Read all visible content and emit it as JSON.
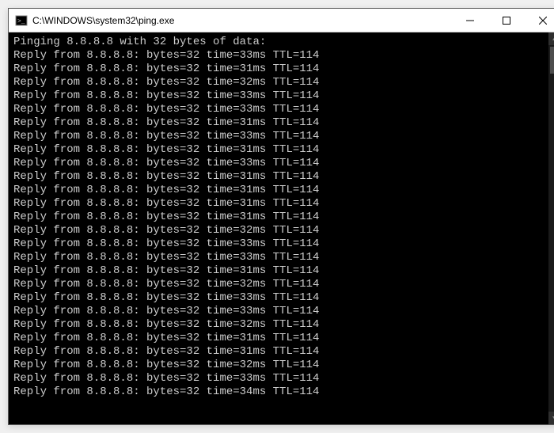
{
  "window": {
    "title": "C:\\WINDOWS\\system32\\ping.exe"
  },
  "console": {
    "header": "Pinging 8.8.8.8 with 32 bytes of data:",
    "replies": [
      {
        "from": "8.8.8.8",
        "bytes": 32,
        "time_ms": 33,
        "ttl": 114
      },
      {
        "from": "8.8.8.8",
        "bytes": 32,
        "time_ms": 31,
        "ttl": 114
      },
      {
        "from": "8.8.8.8",
        "bytes": 32,
        "time_ms": 32,
        "ttl": 114
      },
      {
        "from": "8.8.8.8",
        "bytes": 32,
        "time_ms": 33,
        "ttl": 114
      },
      {
        "from": "8.8.8.8",
        "bytes": 32,
        "time_ms": 33,
        "ttl": 114
      },
      {
        "from": "8.8.8.8",
        "bytes": 32,
        "time_ms": 31,
        "ttl": 114
      },
      {
        "from": "8.8.8.8",
        "bytes": 32,
        "time_ms": 33,
        "ttl": 114
      },
      {
        "from": "8.8.8.8",
        "bytes": 32,
        "time_ms": 31,
        "ttl": 114
      },
      {
        "from": "8.8.8.8",
        "bytes": 32,
        "time_ms": 33,
        "ttl": 114
      },
      {
        "from": "8.8.8.8",
        "bytes": 32,
        "time_ms": 31,
        "ttl": 114
      },
      {
        "from": "8.8.8.8",
        "bytes": 32,
        "time_ms": 31,
        "ttl": 114
      },
      {
        "from": "8.8.8.8",
        "bytes": 32,
        "time_ms": 31,
        "ttl": 114
      },
      {
        "from": "8.8.8.8",
        "bytes": 32,
        "time_ms": 31,
        "ttl": 114
      },
      {
        "from": "8.8.8.8",
        "bytes": 32,
        "time_ms": 32,
        "ttl": 114
      },
      {
        "from": "8.8.8.8",
        "bytes": 32,
        "time_ms": 33,
        "ttl": 114
      },
      {
        "from": "8.8.8.8",
        "bytes": 32,
        "time_ms": 33,
        "ttl": 114
      },
      {
        "from": "8.8.8.8",
        "bytes": 32,
        "time_ms": 31,
        "ttl": 114
      },
      {
        "from": "8.8.8.8",
        "bytes": 32,
        "time_ms": 32,
        "ttl": 114
      },
      {
        "from": "8.8.8.8",
        "bytes": 32,
        "time_ms": 33,
        "ttl": 114
      },
      {
        "from": "8.8.8.8",
        "bytes": 32,
        "time_ms": 33,
        "ttl": 114
      },
      {
        "from": "8.8.8.8",
        "bytes": 32,
        "time_ms": 32,
        "ttl": 114
      },
      {
        "from": "8.8.8.8",
        "bytes": 32,
        "time_ms": 31,
        "ttl": 114
      },
      {
        "from": "8.8.8.8",
        "bytes": 32,
        "time_ms": 31,
        "ttl": 114
      },
      {
        "from": "8.8.8.8",
        "bytes": 32,
        "time_ms": 32,
        "ttl": 114
      },
      {
        "from": "8.8.8.8",
        "bytes": 32,
        "time_ms": 33,
        "ttl": 114
      },
      {
        "from": "8.8.8.8",
        "bytes": 32,
        "time_ms": 34,
        "ttl": 114
      }
    ]
  }
}
